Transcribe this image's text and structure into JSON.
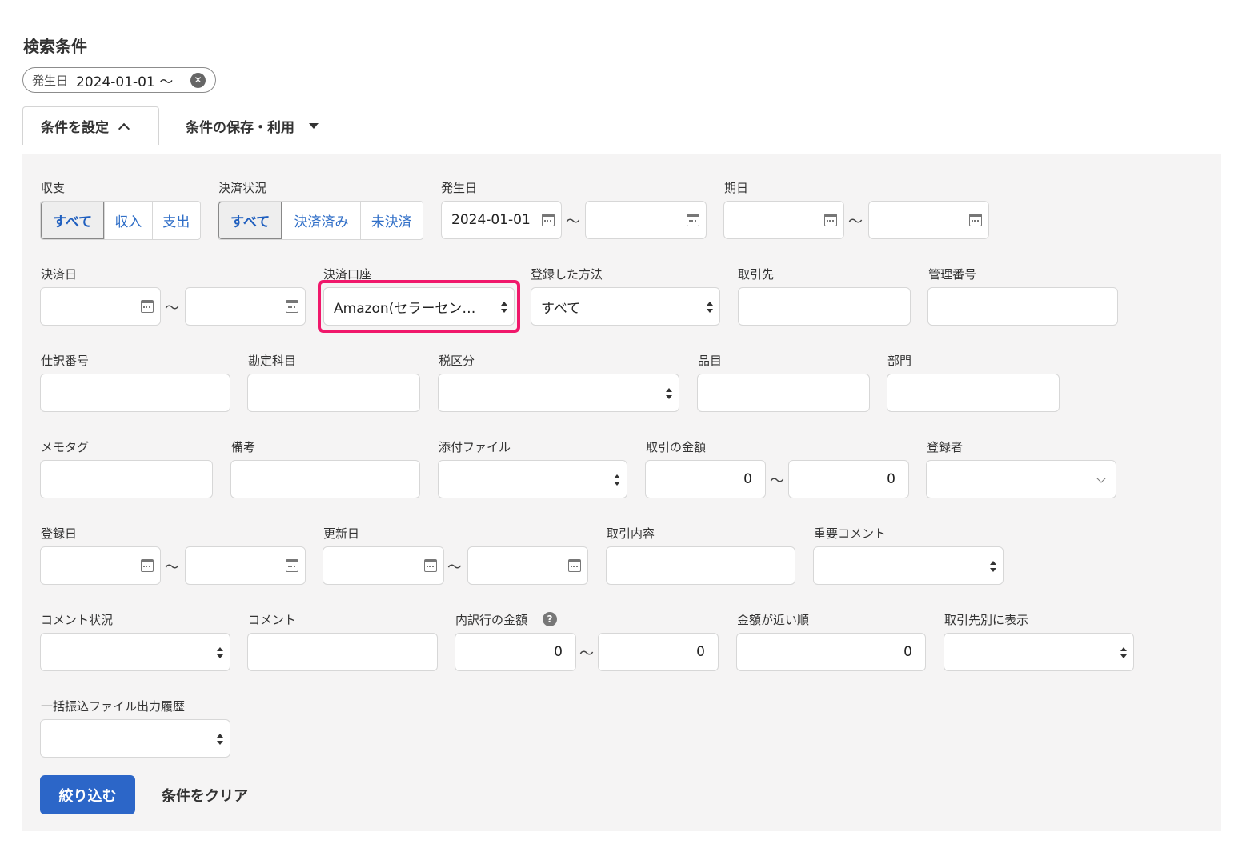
{
  "title": "検索条件",
  "chip": {
    "key": "発生日",
    "value": "2024-01-01 ～",
    "clear_icon": "close-circle-icon"
  },
  "toggle": {
    "set_label": "条件を設定",
    "save_label": "条件の保存・利用"
  },
  "tilde": "～",
  "fields": {
    "income": {
      "label": "収支",
      "options": [
        "すべて",
        "収入",
        "支出"
      ],
      "selected": "すべて"
    },
    "status": {
      "label": "決済状況",
      "options": [
        "すべて",
        "決済済み",
        "未決済"
      ],
      "selected": "すべて"
    },
    "issue_date": {
      "label": "発生日",
      "from": "2024-01-01",
      "to": ""
    },
    "due_date": {
      "label": "期日",
      "from": "",
      "to": ""
    },
    "settle_date": {
      "label": "決済日",
      "from": "",
      "to": ""
    },
    "account": {
      "label": "決済口座",
      "value": "Amazon(セラーセン…"
    },
    "method": {
      "label": "登録した方法",
      "value": "すべて"
    },
    "partner": {
      "label": "取引先",
      "value": ""
    },
    "mgmt_no": {
      "label": "管理番号",
      "value": ""
    },
    "journal_no": {
      "label": "仕訳番号",
      "value": ""
    },
    "account_item": {
      "label": "勘定科目",
      "value": ""
    },
    "tax": {
      "label": "税区分",
      "value": ""
    },
    "item": {
      "label": "品目",
      "value": ""
    },
    "dept": {
      "label": "部門",
      "value": ""
    },
    "memo_tag": {
      "label": "メモタグ",
      "value": ""
    },
    "note": {
      "label": "備考",
      "value": ""
    },
    "attachment": {
      "label": "添付ファイル",
      "value": ""
    },
    "amount": {
      "label": "取引の金額",
      "from": "0",
      "to": "0"
    },
    "registrant": {
      "label": "登録者",
      "value": ""
    },
    "reg_date": {
      "label": "登録日",
      "from": "",
      "to": ""
    },
    "upd_date": {
      "label": "更新日",
      "from": "",
      "to": ""
    },
    "content": {
      "label": "取引内容",
      "value": ""
    },
    "important": {
      "label": "重要コメント",
      "value": ""
    },
    "comment_status": {
      "label": "コメント状況",
      "value": ""
    },
    "comment": {
      "label": "コメント",
      "value": ""
    },
    "line_amount": {
      "label": "内訳行の金額",
      "from": "0",
      "to": "0",
      "help": "?"
    },
    "near_amount": {
      "label": "金額が近い順",
      "value": "0"
    },
    "by_partner": {
      "label": "取引先別に表示",
      "value": ""
    },
    "bulk_history": {
      "label": "一括振込ファイル出力履歴",
      "value": ""
    }
  },
  "actions": {
    "apply": "絞り込む",
    "clear": "条件をクリア"
  },
  "colors": {
    "primary": "#2c66c8",
    "highlight": "#f0186b",
    "panel": "#f5f4f4"
  }
}
